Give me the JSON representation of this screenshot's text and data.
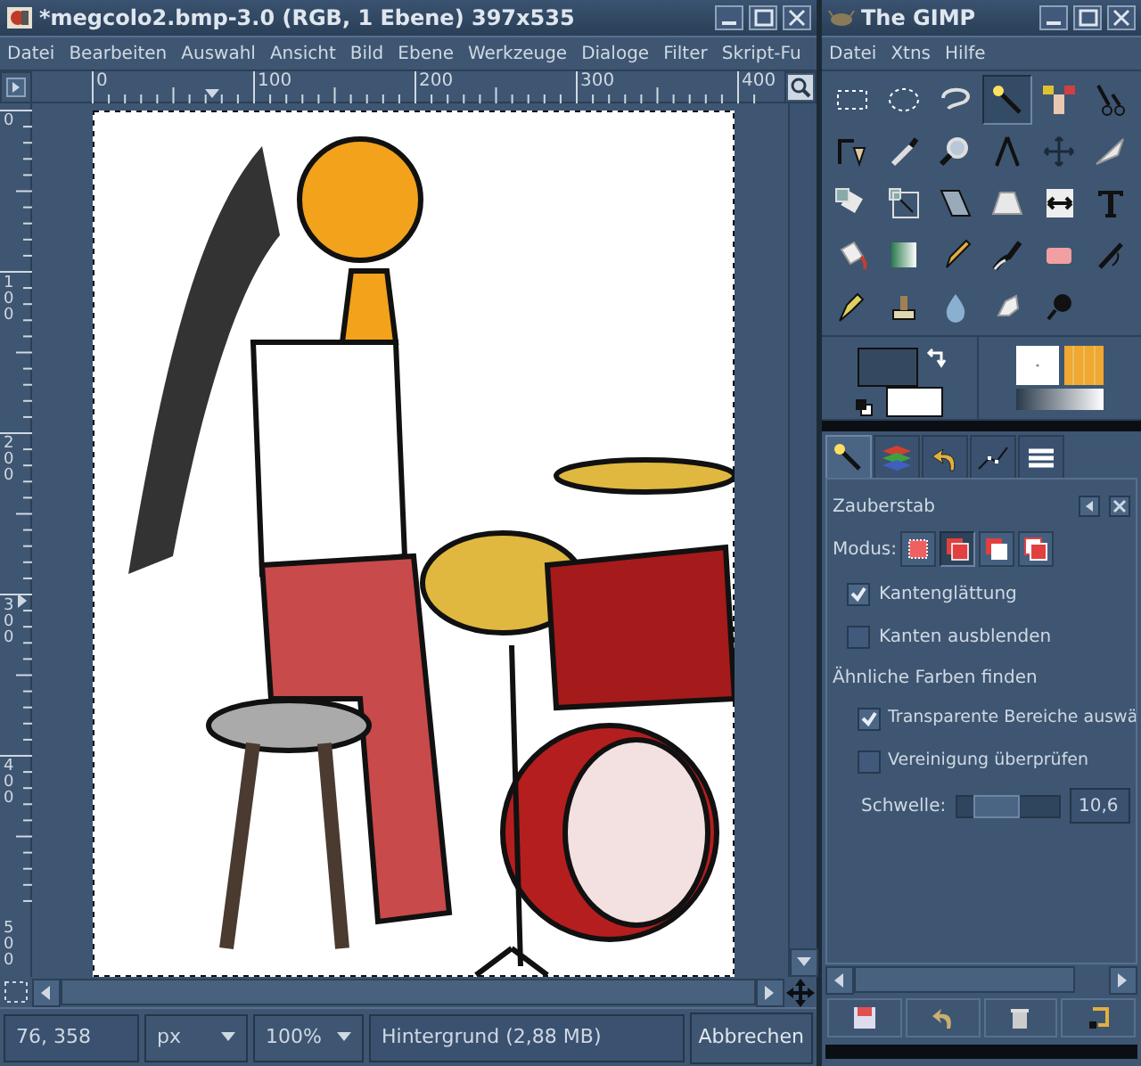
{
  "image_window": {
    "title": "*megcolo2.bmp-3.0 (RGB, 1 Ebene) 397x535",
    "menu": [
      "Datei",
      "Bearbeiten",
      "Auswahl",
      "Ansicht",
      "Bild",
      "Ebene",
      "Werkzeuge",
      "Dialoge",
      "Filter",
      "Skript-Fu"
    ],
    "hruler": [
      "0",
      "100",
      "200",
      "300",
      "400"
    ],
    "vruler": [
      "0",
      "100",
      "200",
      "300",
      "400",
      "500"
    ],
    "canvas": {
      "kind": "picture"
    },
    "status": {
      "coords": "76, 358",
      "unit": "px",
      "zoom": "100%",
      "layer": "Hintergrund (2,88 MB)",
      "cancel": "Abbrechen"
    }
  },
  "toolbox": {
    "title": "The GIMP",
    "menu": [
      "Datei",
      "Xtns",
      "Hilfe"
    ],
    "tools": [
      {
        "selected": false
      },
      {
        "selected": false
      },
      {
        "selected": false
      },
      {
        "selected": true
      },
      {
        "selected": false
      },
      {
        "selected": false
      },
      {
        "selected": false
      },
      {
        "selected": false
      },
      {
        "selected": false
      },
      {
        "selected": false
      },
      {
        "selected": false
      },
      {
        "selected": false
      },
      {
        "selected": false
      },
      {
        "selected": false
      },
      {
        "selected": false
      },
      {
        "selected": false
      },
      {
        "selected": false
      },
      {
        "selected": false
      },
      {
        "selected": false
      },
      {
        "selected": false
      },
      {
        "selected": false
      },
      {
        "selected": false
      },
      {
        "selected": false
      },
      {
        "selected": false
      },
      {
        "selected": false
      },
      {
        "selected": false
      },
      {
        "selected": false
      },
      {
        "selected": false
      },
      {
        "selected": false
      }
    ],
    "foreground": {
      "color": "#34495f"
    },
    "background": {
      "color": "#ffffff"
    },
    "dock_tabs": [
      {
        "selected": true
      },
      {
        "selected": false
      },
      {
        "selected": false
      },
      {
        "selected": false
      },
      {
        "selected": false
      }
    ],
    "tool_options": {
      "title": "Zauberstab",
      "mode_label": "Modus:",
      "modes": [
        {
          "selected": false
        },
        {
          "selected": true
        },
        {
          "selected": false
        },
        {
          "selected": false
        }
      ],
      "options": [
        {
          "label": "Kantenglättung",
          "checked": true
        },
        {
          "label": "Kanten ausblenden",
          "checked": false
        }
      ],
      "section": "Ähnliche Farben finden",
      "sub_options": [
        {
          "label": "Transparente Bereiche auswä",
          "checked": true
        },
        {
          "label": "Vereinigung überprüfen",
          "checked": false
        }
      ],
      "threshold": {
        "label": "Schwelle:",
        "level": 0.3,
        "reading": "10,6"
      }
    }
  }
}
